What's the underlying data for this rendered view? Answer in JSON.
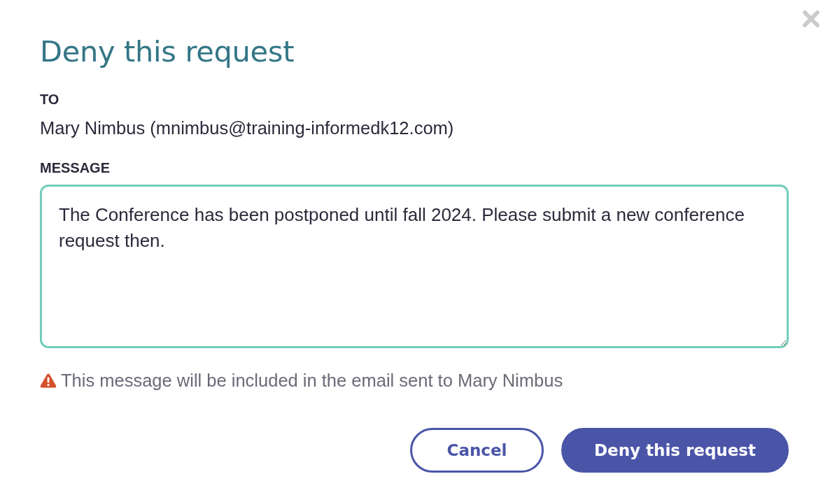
{
  "title": "Deny this request",
  "to": {
    "label": "TO",
    "value": "Mary Nimbus (mnimbus@training-informedk12.com)"
  },
  "message": {
    "label": "MESSAGE",
    "value": "The Conference has been postponed until fall 2024. Please submit a new conference request then."
  },
  "notice": "This message will be included in the email sent to Mary Nimbus",
  "buttons": [
    {
      "label": "Cancel",
      "kind": "secondary"
    },
    {
      "label": "Deny this request",
      "kind": "primary"
    }
  ]
}
